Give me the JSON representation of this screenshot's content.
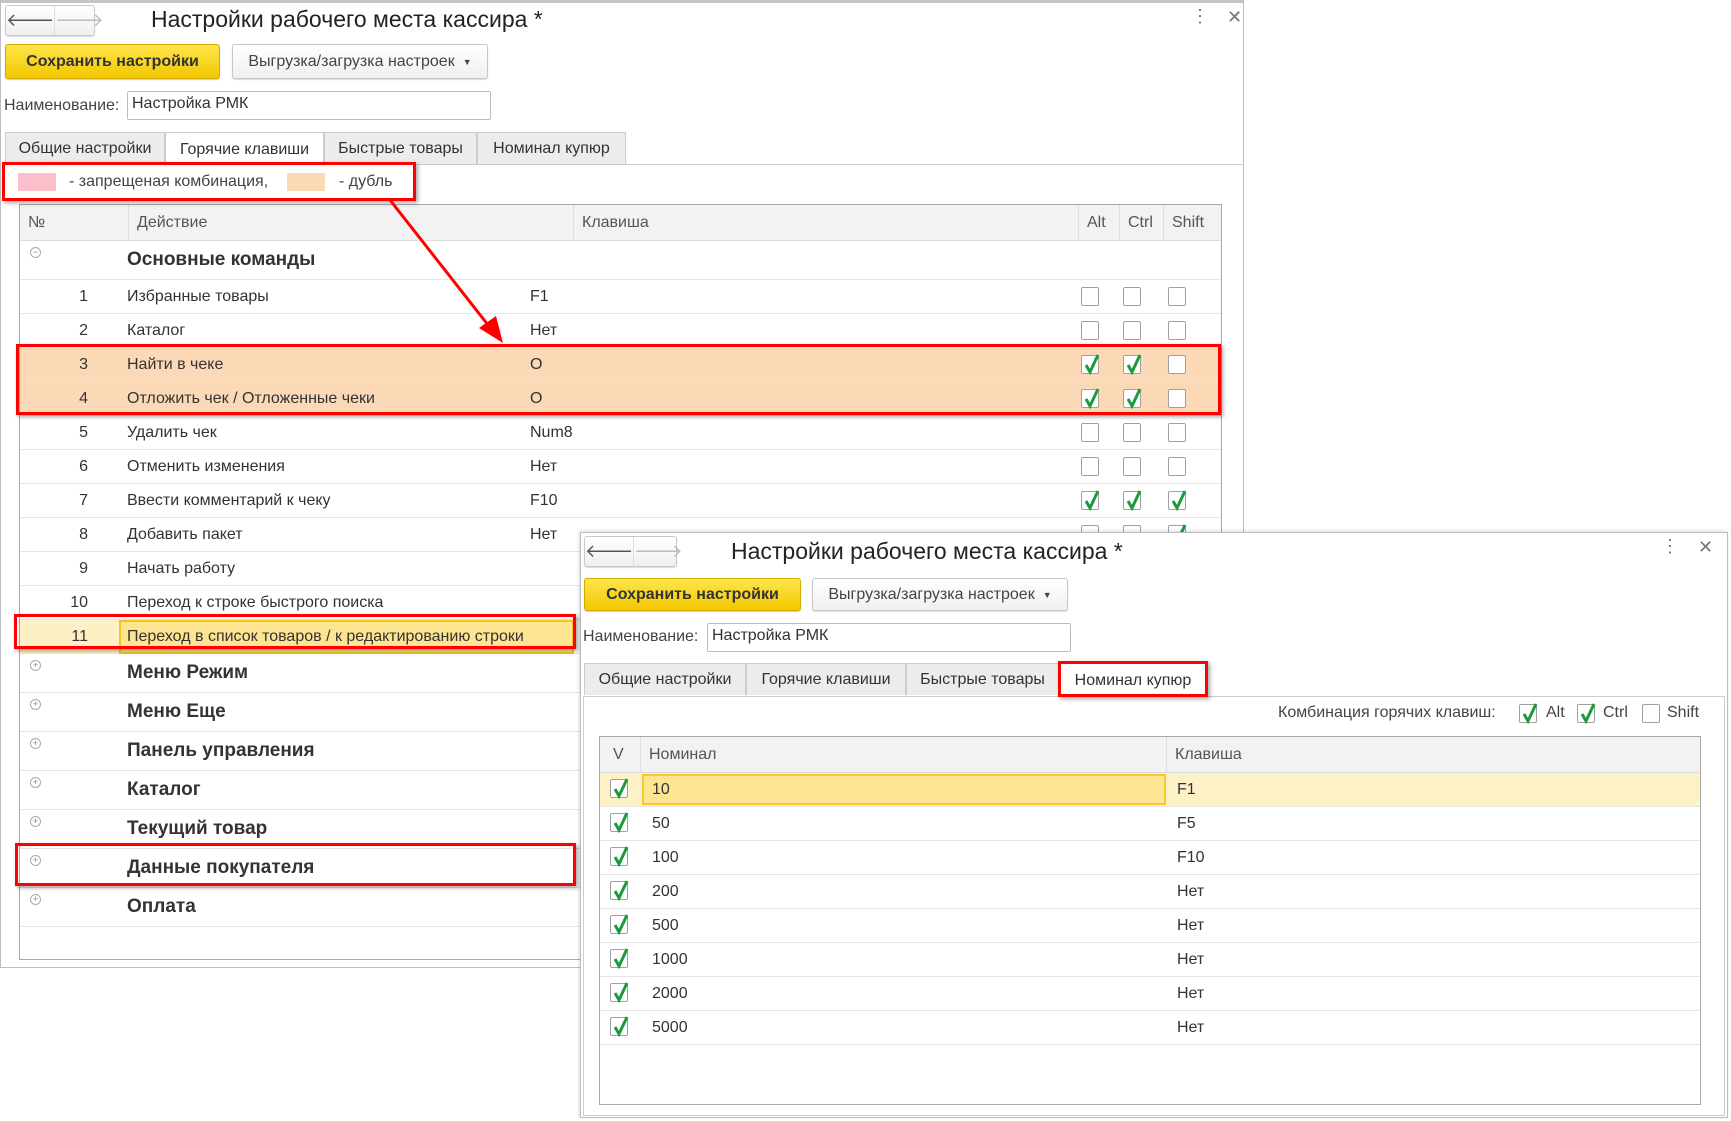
{
  "colors": {
    "forbidden": "#fbc0cb",
    "duplicate": "#fcd9b6",
    "accent": "#f2c800",
    "highlight": "#f00",
    "check": "#1a9b3c"
  },
  "window_back": {
    "title": "Настройки рабочего места кассира *",
    "save_label": "Сохранить настройки",
    "export_label": "Выгрузка/загрузка настроек",
    "name_label": "Наименование:",
    "name_value": "Настройка РМК",
    "tabs": [
      "Общие настройки",
      "Горячие клавиши",
      "Быстрые товары",
      "Номинал купюр"
    ],
    "active_tab": 1,
    "legend": {
      "forbidden": "- запрещеная комбинация,",
      "duplicate": "- дубль"
    },
    "columns": {
      "num": "№",
      "action": "Действие",
      "key": "Клавиша",
      "alt": "Alt",
      "ctrl": "Ctrl",
      "shift": "Shift"
    },
    "rows": [
      {
        "type": "group",
        "label": "Основные команды",
        "expanded": true
      },
      {
        "type": "item",
        "num": "1",
        "action": "Избранные товары",
        "key": "F1",
        "alt": false,
        "ctrl": false,
        "shift": false
      },
      {
        "type": "item",
        "num": "2",
        "action": "Каталог",
        "key": "Нет",
        "alt": false,
        "ctrl": false,
        "shift": false
      },
      {
        "type": "item",
        "num": "3",
        "action": "Найти в чеке",
        "key": "O",
        "alt": true,
        "ctrl": true,
        "shift": false,
        "state": "duplicate"
      },
      {
        "type": "item",
        "num": "4",
        "action": "Отложить чек / Отложенные чеки",
        "key": "O",
        "alt": true,
        "ctrl": true,
        "shift": false,
        "state": "duplicate"
      },
      {
        "type": "item",
        "num": "5",
        "action": "Удалить чек",
        "key": "Num8",
        "alt": false,
        "ctrl": false,
        "shift": false
      },
      {
        "type": "item",
        "num": "6",
        "action": "Отменить изменения",
        "key": "Нет",
        "alt": false,
        "ctrl": false,
        "shift": false
      },
      {
        "type": "item",
        "num": "7",
        "action": "Ввести комментарий к чеку",
        "key": "F10",
        "alt": true,
        "ctrl": true,
        "shift": true
      },
      {
        "type": "item",
        "num": "8",
        "action": "Добавить пакет",
        "key": "Нет",
        "alt": false,
        "ctrl": false,
        "shift": true
      },
      {
        "type": "item",
        "num": "9",
        "action": "Начать работу",
        "key": "",
        "alt": false,
        "ctrl": false,
        "shift": false
      },
      {
        "type": "item",
        "num": "10",
        "action": "Переход к строке быстрого поиска",
        "key": "",
        "alt": false,
        "ctrl": false,
        "shift": false
      },
      {
        "type": "item",
        "num": "11",
        "action": "Переход в список товаров / к редактированию строки",
        "key": "",
        "alt": false,
        "ctrl": false,
        "shift": false,
        "state": "selected"
      },
      {
        "type": "group",
        "label": "Меню Режим",
        "expanded": false
      },
      {
        "type": "group",
        "label": "Меню Еще",
        "expanded": false
      },
      {
        "type": "group",
        "label": "Панель управления",
        "expanded": false
      },
      {
        "type": "group",
        "label": "Каталог",
        "expanded": false
      },
      {
        "type": "group",
        "label": "Текущий товар",
        "expanded": false
      },
      {
        "type": "group",
        "label": "Данные покупателя",
        "expanded": false
      },
      {
        "type": "group",
        "label": "Оплата",
        "expanded": false
      }
    ]
  },
  "window_front": {
    "title": "Настройки рабочего места кассира *",
    "save_label": "Сохранить настройки",
    "export_label": "Выгрузка/загрузка настроек",
    "name_label": "Наименование:",
    "name_value": "Настройка РМК",
    "tabs": [
      "Общие настройки",
      "Горячие клавиши",
      "Быстрые товары",
      "Номинал купюр"
    ],
    "active_tab": 3,
    "combo": {
      "label": "Комбинация горячих клавиш:",
      "alt": {
        "label": "Alt",
        "checked": true
      },
      "ctrl": {
        "label": "Ctrl",
        "checked": true
      },
      "shift": {
        "label": "Shift",
        "checked": false
      }
    },
    "columns": {
      "v": "V",
      "nominal": "Номинал",
      "key": "Клавиша"
    },
    "rows": [
      {
        "v": true,
        "nominal": "10",
        "key": "F1"
      },
      {
        "v": true,
        "nominal": "50",
        "key": "F5"
      },
      {
        "v": true,
        "nominal": "100",
        "key": "F10"
      },
      {
        "v": true,
        "nominal": "200",
        "key": "Нет"
      },
      {
        "v": true,
        "nominal": "500",
        "key": "Нет"
      },
      {
        "v": true,
        "nominal": "1000",
        "key": "Нет"
      },
      {
        "v": true,
        "nominal": "2000",
        "key": "Нет"
      },
      {
        "v": true,
        "nominal": "5000",
        "key": "Нет"
      }
    ]
  }
}
